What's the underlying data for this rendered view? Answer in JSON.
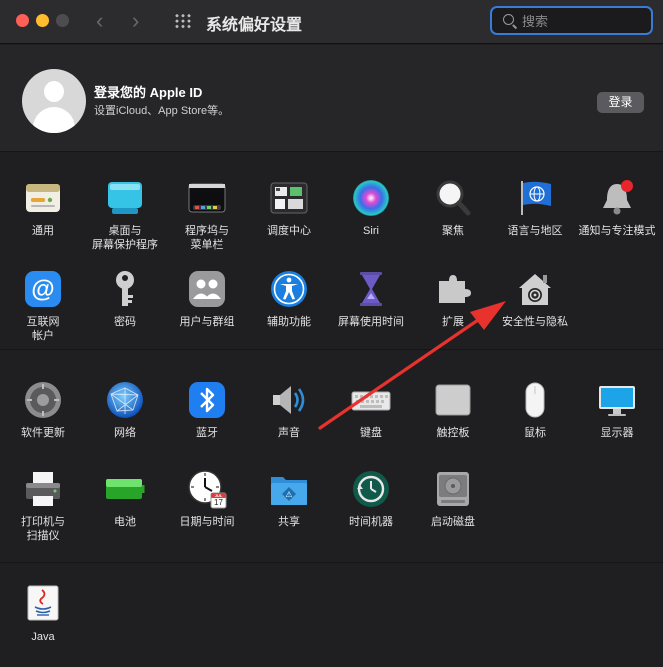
{
  "window": {
    "title": "系统偏好设置"
  },
  "search": {
    "placeholder": "搜索"
  },
  "account": {
    "title": "登录您的 Apple ID",
    "subtitle": "设置iCloud、App Store等。",
    "login_button": "登录"
  },
  "row1": [
    {
      "label": "通用",
      "icon": "general-icon"
    },
    {
      "label": "桌面与\n屏幕保护程序",
      "icon": "desktop-screensaver-icon"
    },
    {
      "label": "程序坞与\n菜单栏",
      "icon": "dock-menubar-icon"
    },
    {
      "label": "调度中心",
      "icon": "mission-control-icon"
    },
    {
      "label": "Siri",
      "icon": "siri-icon"
    },
    {
      "label": "聚焦",
      "icon": "spotlight-icon"
    },
    {
      "label": "语言与地区",
      "icon": "language-region-icon"
    },
    {
      "label": "通知与专注模式",
      "icon": "notifications-icon"
    }
  ],
  "row2": [
    {
      "label": "互联网\n帐户",
      "icon": "internet-accounts-icon"
    },
    {
      "label": "密码",
      "icon": "passwords-icon"
    },
    {
      "label": "用户与群组",
      "icon": "users-groups-icon"
    },
    {
      "label": "辅助功能",
      "icon": "accessibility-icon"
    },
    {
      "label": "屏幕使用时间",
      "icon": "screen-time-icon"
    },
    {
      "label": "扩展",
      "icon": "extensions-icon"
    },
    {
      "label": "安全性与隐私",
      "icon": "security-privacy-icon"
    }
  ],
  "row3": [
    {
      "label": "软件更新",
      "icon": "software-update-icon"
    },
    {
      "label": "网络",
      "icon": "network-icon"
    },
    {
      "label": "蓝牙",
      "icon": "bluetooth-icon"
    },
    {
      "label": "声音",
      "icon": "sound-icon"
    },
    {
      "label": "键盘",
      "icon": "keyboard-icon"
    },
    {
      "label": "触控板",
      "icon": "trackpad-icon"
    },
    {
      "label": "鼠标",
      "icon": "mouse-icon"
    },
    {
      "label": "显示器",
      "icon": "displays-icon"
    }
  ],
  "row4": [
    {
      "label": "打印机与\n扫描仪",
      "icon": "printers-icon"
    },
    {
      "label": "电池",
      "icon": "battery-icon"
    },
    {
      "label": "日期与时间",
      "icon": "date-time-icon"
    },
    {
      "label": "共享",
      "icon": "sharing-icon"
    },
    {
      "label": "时间机器",
      "icon": "time-machine-icon"
    },
    {
      "label": "启动磁盘",
      "icon": "startup-disk-icon"
    }
  ],
  "row5": [
    {
      "label": "Java",
      "icon": "java-icon"
    }
  ],
  "calendar": {
    "month": "JUL",
    "day": "17"
  },
  "colors": {
    "accent": "#3a7bd5",
    "arrow": "#e8322e",
    "window": "#1f1f21",
    "titlebar": "#2c2c2e"
  }
}
